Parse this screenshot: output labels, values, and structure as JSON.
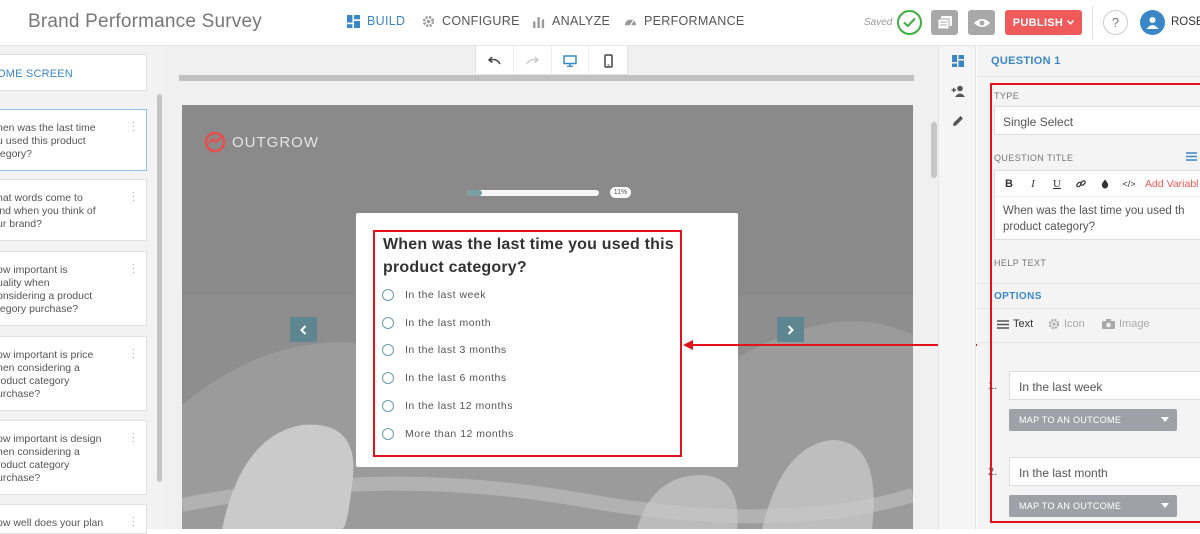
{
  "header": {
    "app_title": "Brand Performance Survey",
    "tabs": [
      {
        "label": "BUILD",
        "icon": "grid-icon",
        "active": true
      },
      {
        "label": "CONFIGURE",
        "icon": "gear-icon",
        "active": false
      },
      {
        "label": "ANALYZE",
        "icon": "bar-chart-icon",
        "active": false
      },
      {
        "label": "PERFORMANCE",
        "icon": "gauge-icon",
        "active": false
      }
    ],
    "saved_label": "Saved",
    "publish_label": "PUBLISH",
    "help_label": "?",
    "user_name": "ROSE",
    "accent_color": "#3a87c8",
    "publish_color": "#ef5a5a"
  },
  "sidebar": {
    "welcome_label": "OME SCREEN",
    "items": [
      {
        "label": "hen was the last time\nu used this product\ntegory?"
      },
      {
        "label": "hat words come to\nind when you think of\nur brand?"
      },
      {
        "label": "ow important is\nuality when\nonsidering a product\ntegory purchase?"
      },
      {
        "label": "ow important is price\nhen considering a\nroduct category\nurchase?"
      },
      {
        "label": "ow important is design\nhen considering a\nroduct category\nurchase?"
      },
      {
        "label": "ow well does your plan"
      }
    ]
  },
  "preview": {
    "logo_text": "OUTGROW",
    "progress_percent": 11,
    "progress_label": "11%",
    "question_title": "When was the last time you used this product category?",
    "options": [
      "In the last week",
      "In the last month",
      "In the last 3 months",
      "In the last 6 months",
      "In the last 12 months",
      "More than 12 months"
    ]
  },
  "panel": {
    "header": "QUESTION 1",
    "type_label": "TYPE",
    "type_value": "Single Select",
    "question_title_label": "QUESTION TITLE",
    "add_variable_label": "Add Variabl",
    "title_text": "When was the last time you used th\nproduct category?",
    "help_text_label": "HELP TEXT",
    "options_label": "OPTIONS",
    "option_types": [
      {
        "label": "Text",
        "icon": "lines-icon"
      },
      {
        "label": "Icon",
        "icon": "gear-icon"
      },
      {
        "label": "Image",
        "icon": "camera-icon"
      }
    ],
    "options": [
      {
        "number": "1.",
        "value": "In the last week",
        "map_label": "MAP TO AN OUTCOME"
      },
      {
        "number": "2.",
        "value": "In the last month",
        "map_label": "MAP TO AN OUTCOME"
      }
    ]
  }
}
